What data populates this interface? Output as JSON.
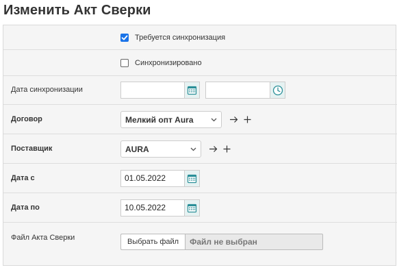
{
  "page": {
    "title": "Изменить Акт Сверки"
  },
  "form": {
    "sync_required": {
      "label": "Требуется синхронизация",
      "checked": true
    },
    "synchronized": {
      "label": "Синхронизировано",
      "checked": false
    },
    "sync_date": {
      "label": "Дата синхронизации",
      "date_value": "",
      "time_value": ""
    },
    "contract": {
      "label": "Договор",
      "value": "Мелкий опт Aura"
    },
    "supplier": {
      "label": "Поставщик",
      "value": "AURA"
    },
    "date_from": {
      "label": "Дата с",
      "value": "01.05.2022"
    },
    "date_to": {
      "label": "Дата по",
      "value": "10.05.2022"
    },
    "file": {
      "label": "Файл Акта Сверки",
      "button_label": "Выбрать файл",
      "status": "Файл не выбран"
    }
  },
  "icons": {
    "calendar": "calendar-icon",
    "clock": "clock-icon",
    "arrow": "arrow-right-icon",
    "plus": "plus-icon",
    "chevron": "chevron-down-icon"
  },
  "colors": {
    "checkbox_accent": "#1a73e8",
    "addon_background": "#e6f2f2",
    "icon_teal": "#2a8f98",
    "panel_background": "#f5f5f5"
  }
}
